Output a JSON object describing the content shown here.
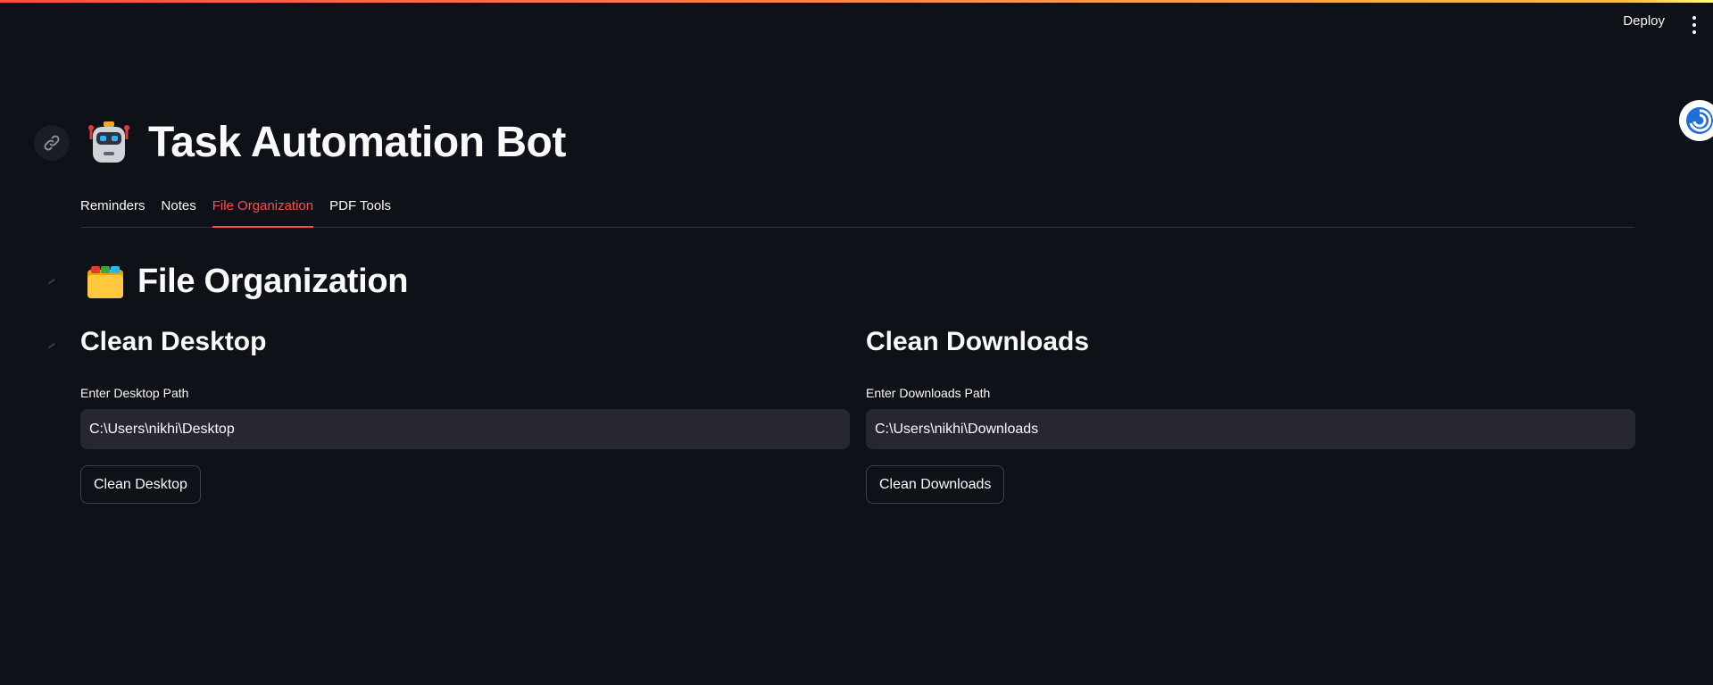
{
  "header": {
    "deploy_label": "Deploy",
    "menu_icon": "more-vertical-icon"
  },
  "app": {
    "title_emoji": "🤖",
    "title": "Task Automation Bot"
  },
  "tabs": [
    {
      "label": "Reminders",
      "active": false
    },
    {
      "label": "Notes",
      "active": false
    },
    {
      "label": "File Organization",
      "active": true
    },
    {
      "label": "PDF Tools",
      "active": false
    }
  ],
  "section": {
    "emoji": "🗂️",
    "title": "File Organization"
  },
  "desktop": {
    "heading": "Clean Desktop",
    "field_label": "Enter Desktop Path",
    "path_value": "C:\\Users\\nikhi\\Desktop",
    "button_label": "Clean Desktop"
  },
  "downloads": {
    "heading": "Clean Downloads",
    "field_label": "Enter Downloads Path",
    "path_value": "C:\\Users\\nikhi\\Downloads",
    "button_label": "Clean Downloads"
  },
  "colors": {
    "background": "#0e1117",
    "accent": "#ff4b4b",
    "input_bg": "#262730"
  }
}
